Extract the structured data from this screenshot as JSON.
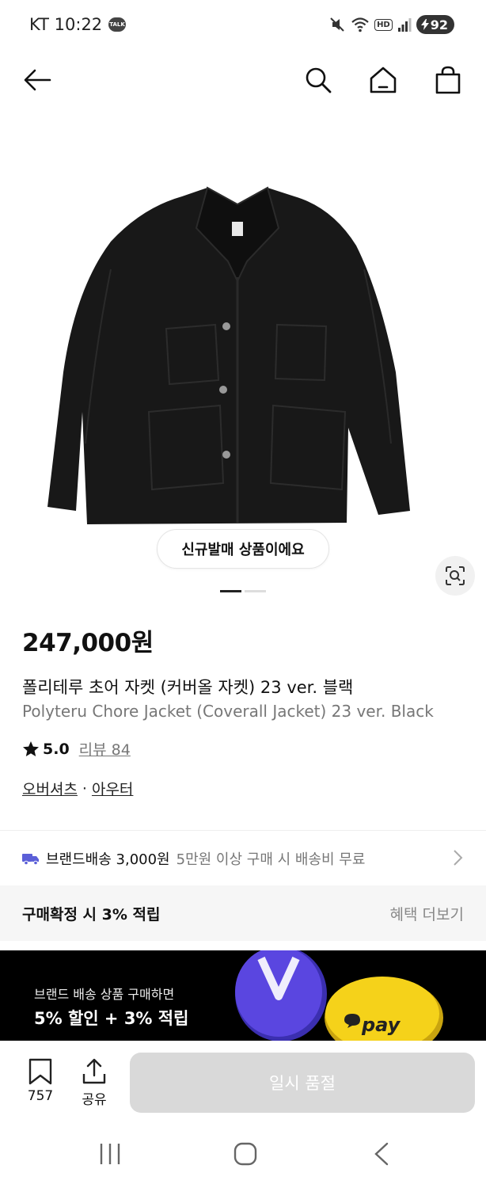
{
  "status_bar": {
    "time": "KT 10:22",
    "talk_badge": "TALK",
    "hd": "HD",
    "battery": "92"
  },
  "nav": {
    "icons": [
      "back-arrow-icon",
      "search-icon",
      "home-icon",
      "shopping-bag-icon"
    ]
  },
  "product": {
    "badge": "신규발매 상품이에요",
    "image_count": 2,
    "image_index": 1,
    "price": "247,000원",
    "name_ko": "폴리테루 초어 자켓 (커버올 자켓) 23 ver. 블랙",
    "name_en": "Polyteru Chore Jacket (Coverall Jacket) 23 ver. Black",
    "rating": "5.0",
    "review_label": "리뷰 84",
    "categories": [
      "오버셔츠",
      "아우터"
    ],
    "category_separator": "·"
  },
  "shipping": {
    "label": "브랜드배송 3,000원",
    "free_note": "5만원 이상 구매 시 배송비 무료"
  },
  "points": {
    "label": "구매확정 시 3% 적립",
    "more": "혜택 더보기"
  },
  "banner": {
    "line1": "브랜드 배송 상품 구매하면",
    "line2": "5% 할인 + 3% 적립",
    "pay_text": "pay",
    "colors": {
      "coin_purple": "#5a46e0",
      "coin_yellow": "#f5d21a"
    }
  },
  "bottom_bar": {
    "bookmark_count": "757",
    "share_label": "공유",
    "soldout_label": "일시 품절"
  }
}
